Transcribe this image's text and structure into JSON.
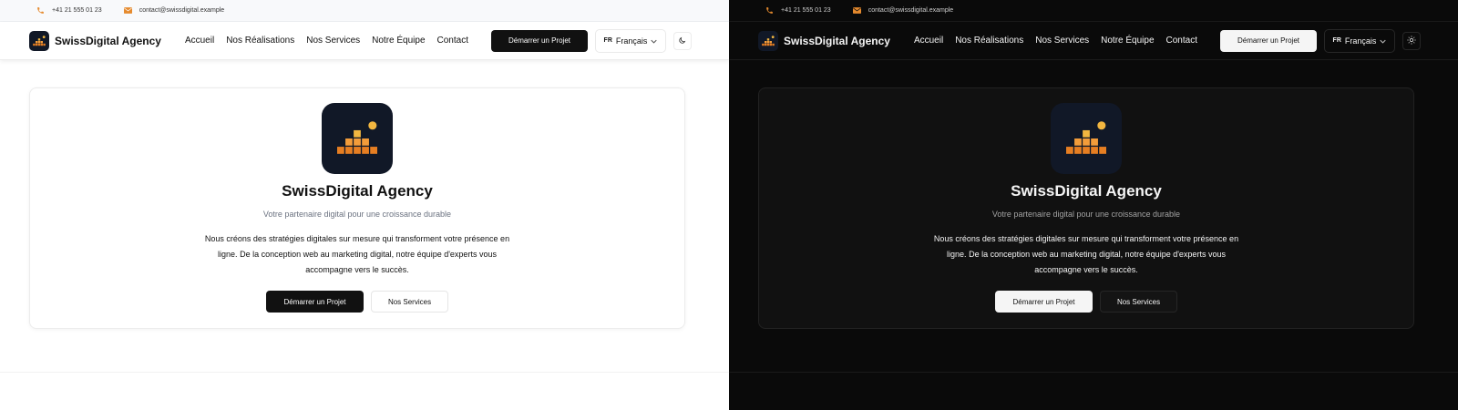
{
  "topbar": {
    "phone": "+41 21 555 01 23",
    "email": "contact@swissdigital.example",
    "phone_icon": "phone-icon",
    "email_icon": "mail-icon"
  },
  "nav": {
    "brand": "SwissDigital Agency",
    "links": [
      "Accueil",
      "Nos Réalisations",
      "Nos Services",
      "Notre Équipe",
      "Contact"
    ],
    "cta": "Démarrer un Projet",
    "lang_code": "FR",
    "lang_label": "Français"
  },
  "hero": {
    "title": "SwissDigital Agency",
    "subtitle": "Votre partenaire digital pour une croissance durable",
    "description": "Nous créons des stratégies digitales sur mesure qui transforment votre présence en ligne. De la conception web au marketing digital, notre équipe d'experts vous accompagne vers le succès.",
    "primary_button": "Démarrer un Projet",
    "secondary_button": "Nos Services"
  },
  "theme": {
    "light_toggle_icon": "moon-icon",
    "dark_toggle_icon": "sun-icon"
  },
  "colors": {
    "accent": "#e58a2e",
    "logo_bg": "#111827",
    "logo_dot": "#f2b640"
  }
}
